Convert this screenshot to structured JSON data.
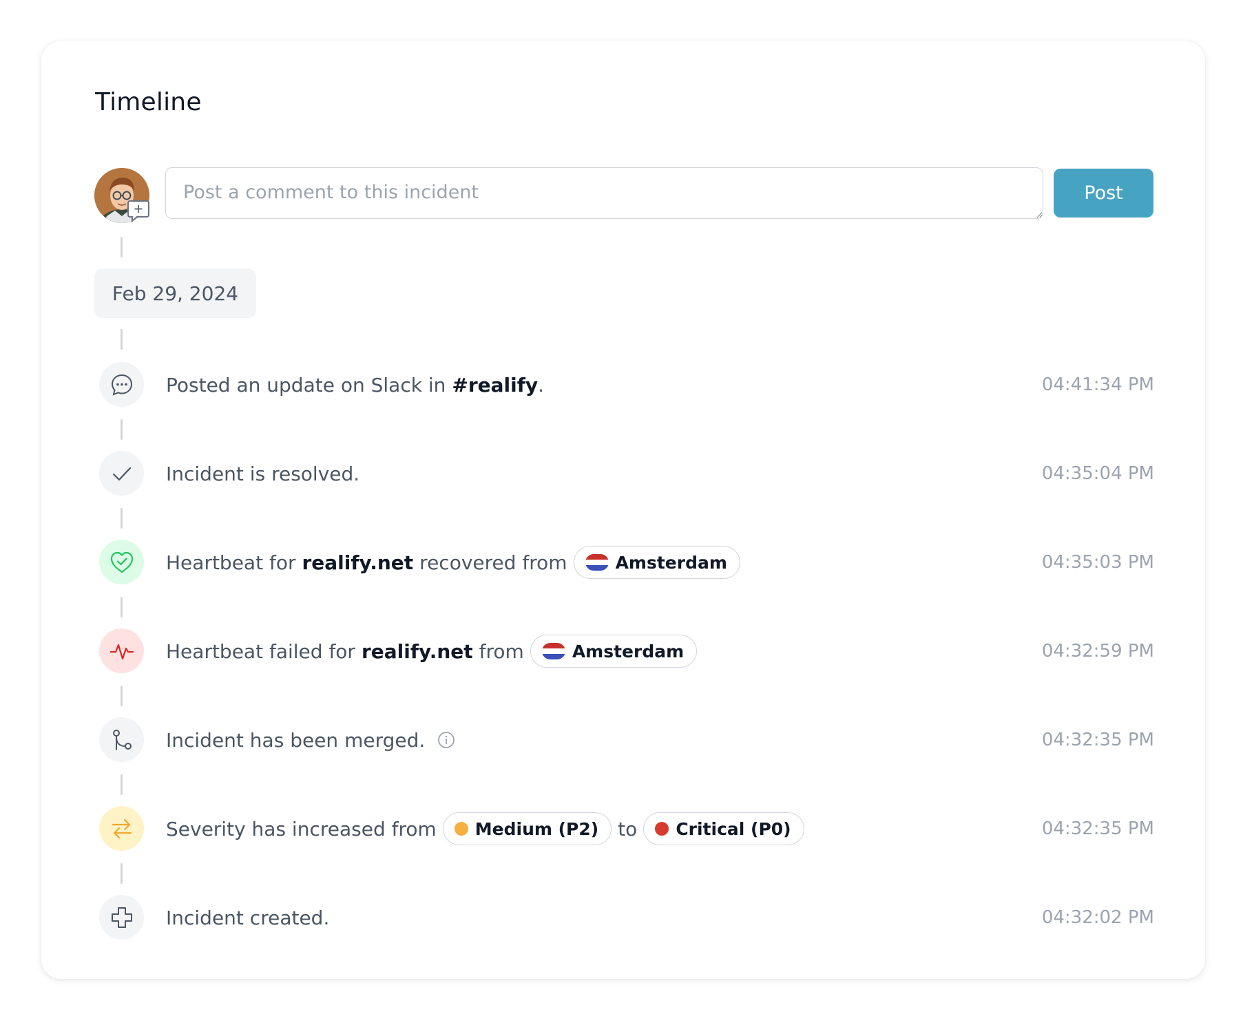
{
  "timeline": {
    "title": "Timeline",
    "composer": {
      "placeholder": "Post a comment to this incident",
      "value": "",
      "post_label": "Post"
    },
    "date_label": "Feb 29, 2024",
    "events": [
      {
        "icon": "chat-bubble-icon",
        "text_before": "Posted an update on Slack in",
        "bold": "#realify",
        "text_after": ".",
        "time": "04:41:34 PM"
      },
      {
        "icon": "check-icon",
        "text": "Incident is resolved.",
        "time": "04:35:04 PM"
      },
      {
        "icon": "heart-check-icon",
        "text_before": "Heartbeat for",
        "bold": "realify.net",
        "text_after": "recovered from",
        "location": "Amsterdam",
        "time": "04:35:03 PM"
      },
      {
        "icon": "activity-pulse-icon",
        "text_before": "Heartbeat failed for",
        "bold": "realify.net",
        "text_after": "from",
        "location": "Amsterdam",
        "time": "04:32:59 PM"
      },
      {
        "icon": "merge-icon",
        "text": "Incident has been merged.",
        "info_icon": "info-icon",
        "time": "04:32:35 PM"
      },
      {
        "icon": "swap-arrows-icon",
        "text_before": "Severity has increased from",
        "from_severity": "Medium (P2)",
        "connector": "to",
        "to_severity": "Critical (P0)",
        "time": "04:32:35 PM"
      },
      {
        "icon": "plus-outline-icon",
        "text": "Incident created.",
        "time": "04:32:02 PM"
      }
    ]
  },
  "colors": {
    "post_button": "#47a3c2",
    "resolved_heart_bg": "#dcfce7",
    "resolved_heart": "#22c55e",
    "failed_bg": "#fee2e2",
    "failed": "#dc2626",
    "severity_bg": "#fef3c7",
    "severity": "#f0a830",
    "medium_dot": "#f5b041",
    "critical_dot": "#d63b30",
    "flag_red": "#c8312b",
    "flag_white": "#ffffff",
    "flag_blue": "#3b4fb8"
  }
}
